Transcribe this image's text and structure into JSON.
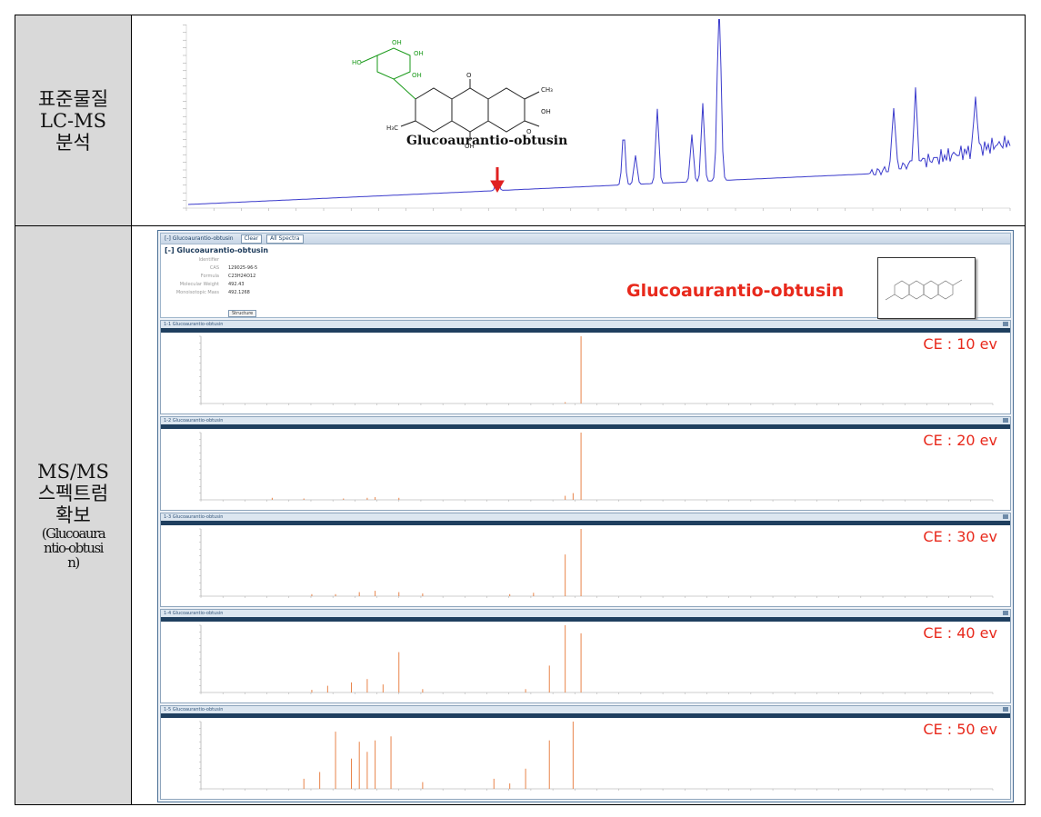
{
  "rows": [
    {
      "label_lines": [
        "표준물질",
        "LC-MS",
        "분석"
      ]
    },
    {
      "label_lines": [
        "MS/MS",
        "스펙트럼",
        "확보"
      ],
      "label_small_lines": [
        "(Glucoaura",
        "ntio-obtusi",
        "n)"
      ]
    }
  ],
  "chromatogram": {
    "compound_label": "Glucoaurantio-obtusin",
    "arrow_color": "#e02020",
    "trace_color": "#3b3bcc"
  },
  "spectra_window": {
    "tab_title": "[-] Glucoaurantio-obtusin",
    "tab_buttons": [
      "Clear",
      "All Spectra"
    ],
    "compound_title": "[-] Glucoaurantio-obtusin",
    "info_fields": [
      {
        "key": "Identifier",
        "value": ""
      },
      {
        "key": "CAS",
        "value": "129025-96-5"
      },
      {
        "key": "Formula",
        "value": "C23H24O12"
      },
      {
        "key": "Molecular Weight",
        "value": "492.43"
      },
      {
        "key": "Monoisotopic Mass",
        "value": "492.1268"
      }
    ],
    "structure_button": "Structure",
    "compound_name_large": "Glucoaurantio-obtusin",
    "spectra": [
      {
        "ce_label": "CE : 10 ev",
        "tab": "1-1 Glucoaurantio-obtusin",
        "peaks": [
          [
            0.46,
            0.02
          ],
          [
            0.48,
            1.0
          ]
        ]
      },
      {
        "ce_label": "CE : 20 ev",
        "tab": "1-2 Glucoaurantio-obtusin",
        "peaks": [
          [
            0.09,
            0.03
          ],
          [
            0.13,
            0.02
          ],
          [
            0.18,
            0.02
          ],
          [
            0.21,
            0.03
          ],
          [
            0.22,
            0.04
          ],
          [
            0.25,
            0.03
          ],
          [
            0.46,
            0.06
          ],
          [
            0.47,
            0.1
          ],
          [
            0.48,
            1.0
          ]
        ]
      },
      {
        "ce_label": "CE : 30 ev",
        "tab": "1-3 Glucoaurantio-obtusin",
        "peaks": [
          [
            0.14,
            0.03
          ],
          [
            0.17,
            0.03
          ],
          [
            0.2,
            0.06
          ],
          [
            0.22,
            0.08
          ],
          [
            0.25,
            0.06
          ],
          [
            0.28,
            0.04
          ],
          [
            0.39,
            0.03
          ],
          [
            0.42,
            0.05
          ],
          [
            0.46,
            0.62
          ],
          [
            0.48,
            1.0
          ]
        ]
      },
      {
        "ce_label": "CE : 40 ev",
        "tab": "1-4 Glucoaurantio-obtusin",
        "peaks": [
          [
            0.14,
            0.04
          ],
          [
            0.16,
            0.1
          ],
          [
            0.19,
            0.15
          ],
          [
            0.21,
            0.2
          ],
          [
            0.23,
            0.12
          ],
          [
            0.25,
            0.6
          ],
          [
            0.28,
            0.05
          ],
          [
            0.41,
            0.05
          ],
          [
            0.44,
            0.4
          ],
          [
            0.46,
            1.0
          ],
          [
            0.48,
            0.88
          ]
        ]
      },
      {
        "ce_label": "CE : 50 ev",
        "tab": "1-5 Glucoaurantio-obtusin",
        "peaks": [
          [
            0.13,
            0.15
          ],
          [
            0.15,
            0.25
          ],
          [
            0.17,
            0.85
          ],
          [
            0.19,
            0.45
          ],
          [
            0.2,
            0.7
          ],
          [
            0.21,
            0.55
          ],
          [
            0.22,
            0.72
          ],
          [
            0.24,
            0.78
          ],
          [
            0.28,
            0.1
          ],
          [
            0.37,
            0.15
          ],
          [
            0.39,
            0.08
          ],
          [
            0.41,
            0.3
          ],
          [
            0.44,
            0.72
          ],
          [
            0.47,
            1.0
          ]
        ]
      }
    ]
  }
}
